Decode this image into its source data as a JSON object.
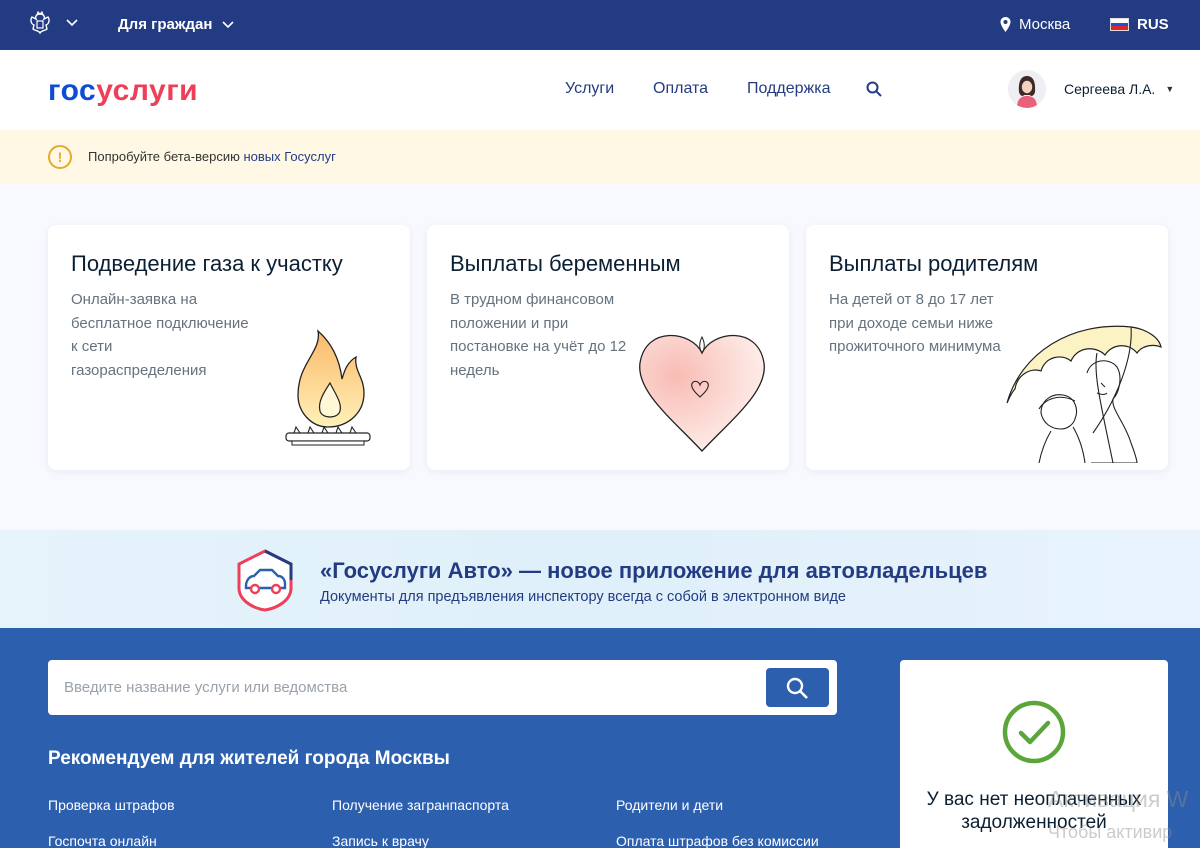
{
  "topbar": {
    "for_citizens": "Для граждан",
    "city": "Москва",
    "lang": "RUS"
  },
  "header": {
    "logo_part1": "гос",
    "logo_part2": "услуги",
    "nav": [
      "Услуги",
      "Оплата",
      "Поддержка"
    ],
    "user_name": "Сергеева Л.А."
  },
  "beta": {
    "text": "Попробуйте бета-версию ",
    "link": "новых Госуслуг"
  },
  "cards": [
    {
      "title": "Подведение газа к участку",
      "desc": "Онлайн-заявка на бесплатное подключение к сети газораспределения",
      "icon": "gas-flame-icon"
    },
    {
      "title": "Выплаты беременным",
      "desc": "В трудном финансовом положении и при постановке на учёт до 12 недель",
      "icon": "heart-icon"
    },
    {
      "title": "Выплаты родителям",
      "desc": "На детей от 8 до 17 лет при доходе семьи ниже прожиточного минимума",
      "icon": "mother-child-umbrella-icon"
    }
  ],
  "auto_banner": {
    "title": "«Госуслуги Авто» — новое приложение для автовладельцев",
    "subtitle": "Документы для предъявления инспектору всегда с собой в электронном виде"
  },
  "search": {
    "placeholder": "Введите название услуги или ведомства"
  },
  "recommend": {
    "title": "Рекомендуем для жителей города Москвы",
    "links": [
      "Проверка штрафов",
      "Получение загранпаспорта",
      "Родители и дети",
      "Госпочта онлайн",
      "Запись к врачу",
      "Оплата штрафов без комиссии"
    ]
  },
  "debt": {
    "text": "У вас нет неоплаченных задолженностей"
  },
  "watermark": {
    "line1": "Активация W",
    "line2": "Чтобы активир"
  },
  "colors": {
    "topbar": "#233b82",
    "brand_blue": "#0d4cd3",
    "brand_red": "#ee3f58",
    "section_blue": "#2c5fae",
    "success_green": "#5aa63a"
  }
}
